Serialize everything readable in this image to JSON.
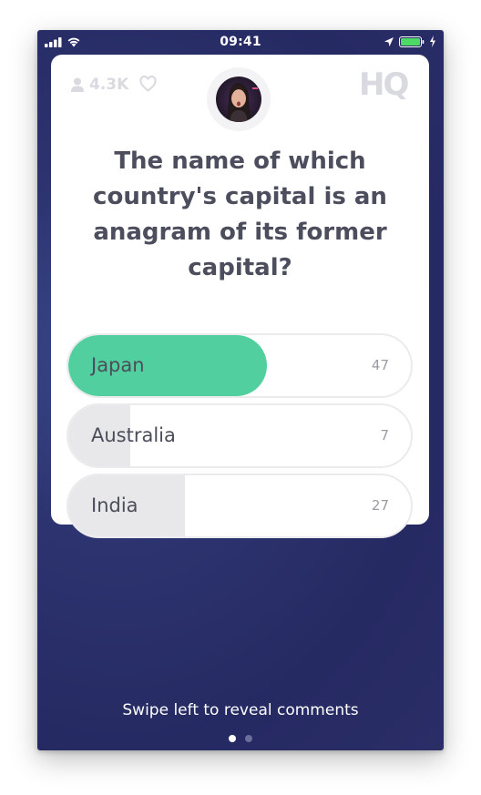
{
  "status_bar": {
    "time": "09:41"
  },
  "header": {
    "viewer_count": "4.3K",
    "logo_text": "HQ",
    "icons": [
      "person-icon",
      "heart-icon",
      "host-avatar"
    ]
  },
  "question": {
    "text": "The name of which country's capital is an anagram of its former capital?"
  },
  "answers": [
    {
      "label": "Japan",
      "count": "47",
      "correct": true,
      "share": 0.58
    },
    {
      "label": "Australia",
      "count": "7",
      "correct": false,
      "share": 0.18
    },
    {
      "label": "India",
      "count": "27",
      "correct": false,
      "share": 0.34
    }
  ],
  "footer": {
    "swipe_hint": "Swipe left to reveal comments",
    "pages": 2,
    "active_page": 1
  },
  "colors": {
    "correct": "#52cf9f",
    "background": "#2c336e",
    "question_text": "#4c4e5e"
  }
}
